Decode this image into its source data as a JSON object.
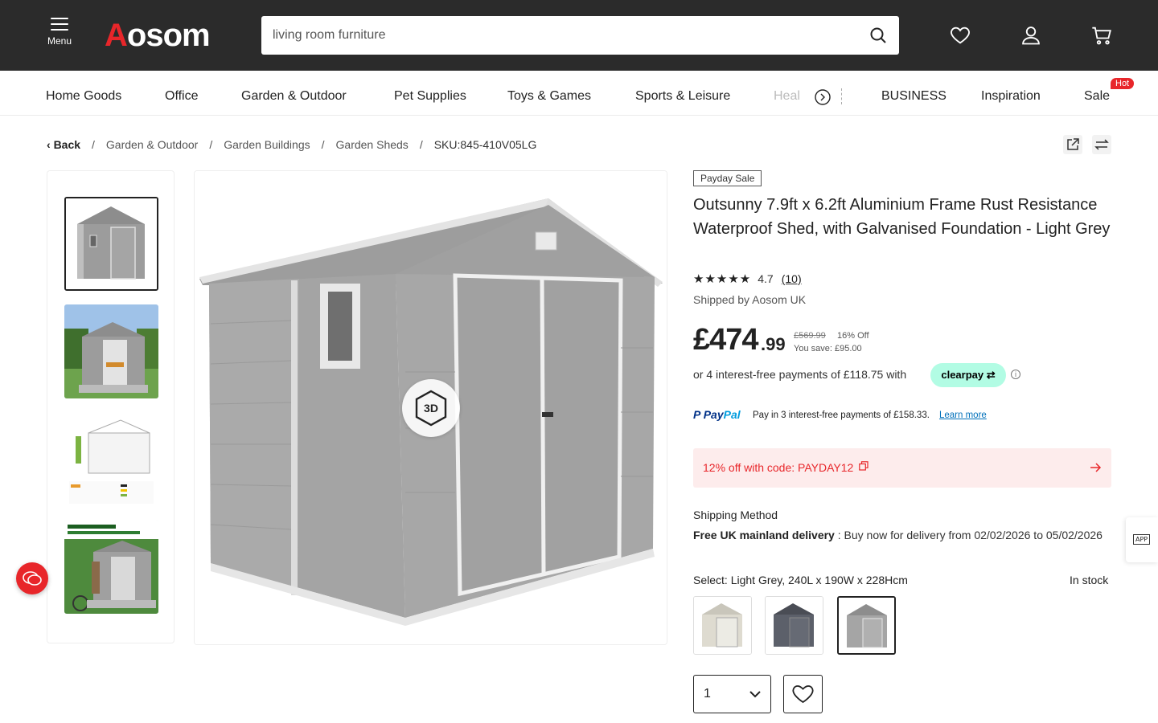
{
  "header": {
    "menu_label": "Menu",
    "logo_text_a": "A",
    "logo_text_rest": "osom",
    "search_value": "living room furniture"
  },
  "nav": {
    "items": [
      "Home Goods",
      "Office",
      "Garden & Outdoor",
      "Pet Supplies",
      "Toys & Games",
      "Sports & Leisure",
      "Heal",
      "BUSINESS",
      "Inspiration",
      "Sale"
    ],
    "hot_badge": "Hot"
  },
  "breadcrumb": {
    "back": "Back",
    "items": [
      "Garden & Outdoor",
      "Garden Buildings",
      "Garden Sheds"
    ],
    "sku": "SKU:845-410V05LG"
  },
  "product": {
    "promo_tag": "Payday Sale",
    "title": "Outsunny 7.9ft x 6.2ft Aluminium Frame Rust Resistance Waterproof Shed, with Galvanised Foundation - Light Grey",
    "rating_stars": 4.7,
    "rating": "4.7",
    "review_count": "(10)",
    "shipped_by": "Shipped by Aosom UK",
    "price_main": "£474",
    "price_decimal": ".99",
    "price_was": "£569.99",
    "price_off": "16% Off",
    "price_save": "You save: £95.00",
    "installments": "or 4 interest-free payments of £118.75 with",
    "clearpay_label": "clearpay",
    "paypal_logo_1": "Pay",
    "paypal_logo_2": "Pal",
    "paypal_text": "Pay in 3 interest-free payments of £158.33.",
    "paypal_link": "Learn more",
    "coupon": "12% off with code: PAYDAY12",
    "shipping_label": "Shipping Method",
    "shipping_bold": "Free UK mainland delivery",
    "shipping_rest": " : Buy now for delivery from 02/02/2026 to 05/02/2026",
    "select_line": "Select: Light Grey, 240L x 190W x 228Hcm",
    "stock": "In stock",
    "quantity": "1",
    "three_d": "3D",
    "app_label": "APP"
  },
  "colors": {
    "brand_red": "#e8262a",
    "header_bg": "#2b2b2b",
    "clearpay_mint": "#b2fce4",
    "coupon_bg": "#fdecec"
  }
}
